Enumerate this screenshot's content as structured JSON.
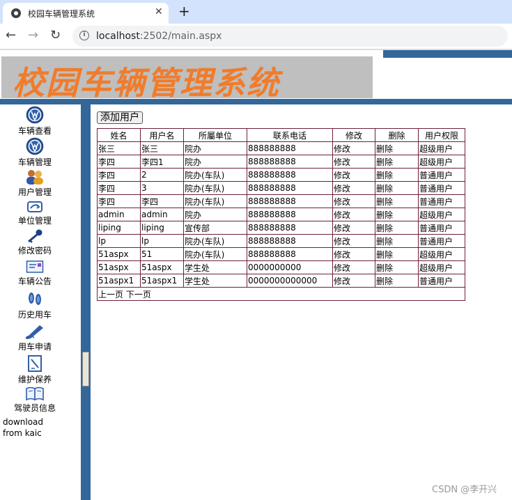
{
  "browser": {
    "tab_title": "校园车辆管理系统",
    "tab_close": "✕",
    "new_tab": "+",
    "url_host": "localhost",
    "url_path": ":2502/main.aspx",
    "back": "←",
    "forward": "→",
    "reload": "↻"
  },
  "header": {
    "banner_title": "校园车辆管理系统"
  },
  "sidebar": {
    "items": [
      {
        "label": "车辆查看",
        "icon": "vw-logo-icon"
      },
      {
        "label": "车辆管理",
        "icon": "vw-logo-icon"
      },
      {
        "label": "用户管理",
        "icon": "users-icon"
      },
      {
        "label": "单位管理",
        "icon": "unit-icon"
      },
      {
        "label": "修改密码",
        "icon": "key-icon"
      },
      {
        "label": "车辆公告",
        "icon": "envelope-icon"
      },
      {
        "label": "历史用车",
        "icon": "footprints-icon"
      },
      {
        "label": "用车申请",
        "icon": "pen-icon"
      },
      {
        "label": "维护保养",
        "icon": "notepad-icon"
      },
      {
        "label": "驾驶员信息",
        "icon": "book-icon"
      }
    ],
    "download_text": "download from kaic"
  },
  "content": {
    "add_button": "添加用户",
    "table": {
      "headers": [
        "姓名",
        "用户名",
        "所屬单位",
        "联系电话",
        "修改",
        "删除",
        "用户权限"
      ],
      "rows": [
        [
          "张三",
          "张三",
          "院办",
          "888888888",
          "修改",
          "删除",
          "超级用户"
        ],
        [
          "李四",
          "李四1",
          "院办",
          "888888888",
          "修改",
          "删除",
          "超级用户"
        ],
        [
          "李四",
          "2",
          "院办(车队)",
          "888888888",
          "修改",
          "删除",
          "普通用户"
        ],
        [
          "李四",
          "3",
          "院办(车队)",
          "888888888",
          "修改",
          "删除",
          "普通用户"
        ],
        [
          "李四",
          "李四",
          "院办(车队)",
          "888888888",
          "修改",
          "删除",
          "普通用户"
        ],
        [
          "admin",
          "admin",
          "院办",
          "888888888",
          "修改",
          "删除",
          "超级用户"
        ],
        [
          "liping",
          "liping",
          "宣传部",
          "888888888",
          "修改",
          "删除",
          "普通用户"
        ],
        [
          "lp",
          "lp",
          "院办(车队)",
          "888888888",
          "修改",
          "删除",
          "普通用户"
        ],
        [
          "51aspx",
          "51",
          "院办(车队)",
          "888888888",
          "修改",
          "删除",
          "超级用户"
        ],
        [
          "51aspx",
          "51aspx",
          "学生处",
          "0000000000",
          "修改",
          "删除",
          "超级用户"
        ],
        [
          "51aspx1",
          "51aspx1",
          "学生处",
          "0000000000000",
          "修改",
          "删除",
          "普通用户"
        ]
      ]
    },
    "pager": {
      "prev": "上一页",
      "next": "下一页"
    }
  },
  "watermark": "CSDN @李开兴",
  "colors": {
    "frame_blue": "#336699",
    "banner_orange": "#f07c2b",
    "table_border": "#6b1f3a"
  }
}
